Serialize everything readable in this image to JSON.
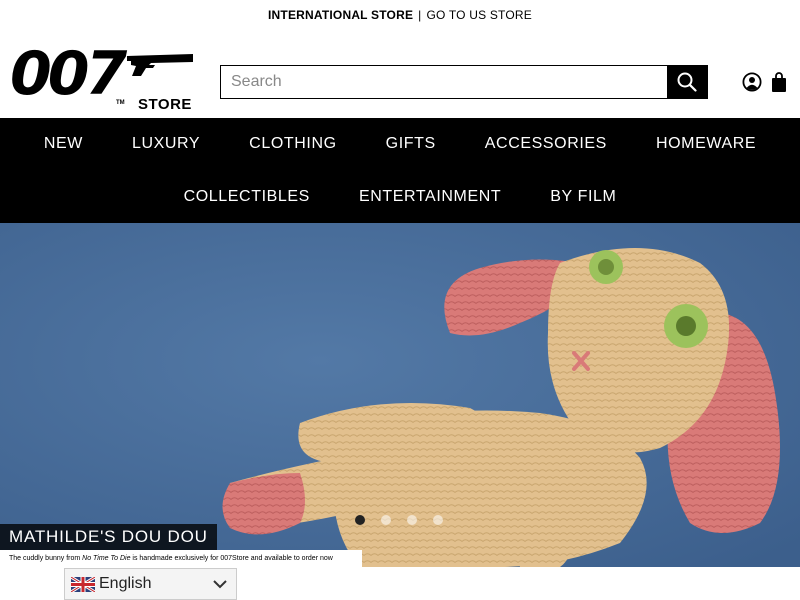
{
  "topbar": {
    "current_store": "INTERNATIONAL STORE",
    "separator": "|",
    "switch_link": "GO TO US STORE"
  },
  "header": {
    "logo_number": "007",
    "logo_tm": "TM",
    "logo_store": "STORE",
    "search_placeholder": "Search",
    "search_value": "",
    "icons": [
      "search-icon",
      "account-icon",
      "shopping-bag-icon"
    ]
  },
  "nav": {
    "row1": [
      "NEW",
      "LUXURY",
      "CLOTHING",
      "GIFTS",
      "ACCESSORIES",
      "HOMEWARE"
    ],
    "row2": [
      "COLLECTIBLES",
      "ENTERTAINMENT",
      "BY FILM"
    ]
  },
  "hero": {
    "title": "MATHILDE'S DOU DOU",
    "subtitle_before": "The cuddly bunny from ",
    "subtitle_film": "No Time To Die",
    "subtitle_after": " is handmade exclusively for 007Store and available to order now",
    "slide_count": 4,
    "active_slide": 1
  },
  "language": {
    "selected": "English",
    "flag": "uk-flag-icon"
  },
  "colors": {
    "nav_bg": "#000000",
    "nav_text": "#ffffff",
    "hero_bg": "#466b98",
    "knit_body": "#e2c08e",
    "knit_pink": "#d97a78",
    "knit_eye": "#9cc25c"
  }
}
